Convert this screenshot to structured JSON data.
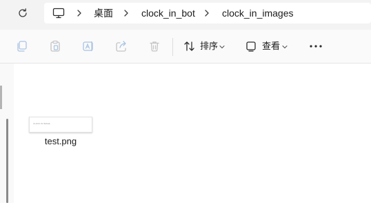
{
  "address_bar": {
    "breadcrumbs": [
      "桌面",
      "clock_in_bot",
      "clock_in_images"
    ]
  },
  "toolbar": {
    "sort_label": "排序",
    "view_label": "查看"
  },
  "files": [
    {
      "name": "test.png",
      "thumbnail_caption": "CLOCK IN IMAGE"
    }
  ],
  "icons": {
    "refresh": "refresh-icon",
    "location": "monitor-icon",
    "separator": "chevron-right-icon",
    "new_copy": "copy-icon",
    "paste": "paste-icon",
    "rename": "rename-icon",
    "share": "share-icon",
    "delete": "trash-icon",
    "sort": "sort-icon",
    "view": "view-icon",
    "more": "more-icon"
  },
  "colors": {
    "accent": "#0067c0",
    "disabled_icon": "#a9c4e4",
    "address_bg": "#f3f3f3",
    "toolbar_bg": "#fafafa"
  }
}
